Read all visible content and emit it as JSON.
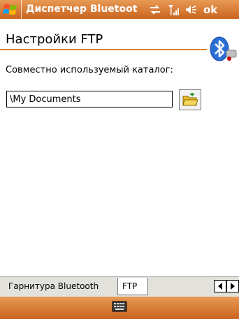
{
  "titlebar": {
    "title": "Диспетчер Bluetoot",
    "ok_label": "ok",
    "icons": [
      "windows-start-icon",
      "connectivity-icon",
      "signal-icon",
      "volume-icon"
    ]
  },
  "header": {
    "title": "Настройки FTP",
    "logo_icon": "bluetooth-icon"
  },
  "main": {
    "shared_folder_label": "Совместно используемый каталог:",
    "shared_folder_value": "\\My Documents",
    "browse_icon": "folder-open-icon"
  },
  "tabs": [
    {
      "label": "Гарнитура Bluetooth"
    },
    {
      "label": "FTP"
    }
  ],
  "bottombar": {
    "icon": "keyboard-icon"
  },
  "colors": {
    "accent": "#d78032",
    "titlebar": "#c9641f"
  }
}
